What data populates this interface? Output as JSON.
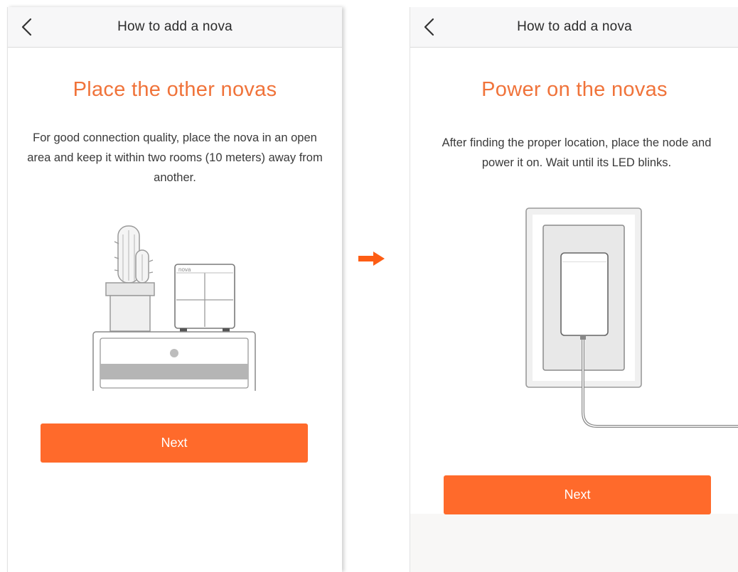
{
  "left_screen": {
    "nav_title": "How to add a nova",
    "heading": "Place the other novas",
    "description": "For good connection quality, place the nova in an open area and keep it within two rooms (10 meters) away from another.",
    "device_label": "nova",
    "next_label": "Next"
  },
  "right_screen": {
    "nav_title": "How to add a nova",
    "heading": "Power on the novas",
    "description": "After finding the proper location, place the node and power it on. Wait until its LED blinks.",
    "next_label": "Next"
  },
  "icons": {
    "back": "chevron-left-icon",
    "transition": "arrow-right-icon"
  },
  "colors": {
    "accent": "#f0733a",
    "button": "#ff6a2b",
    "arrow": "#fd5d14"
  }
}
